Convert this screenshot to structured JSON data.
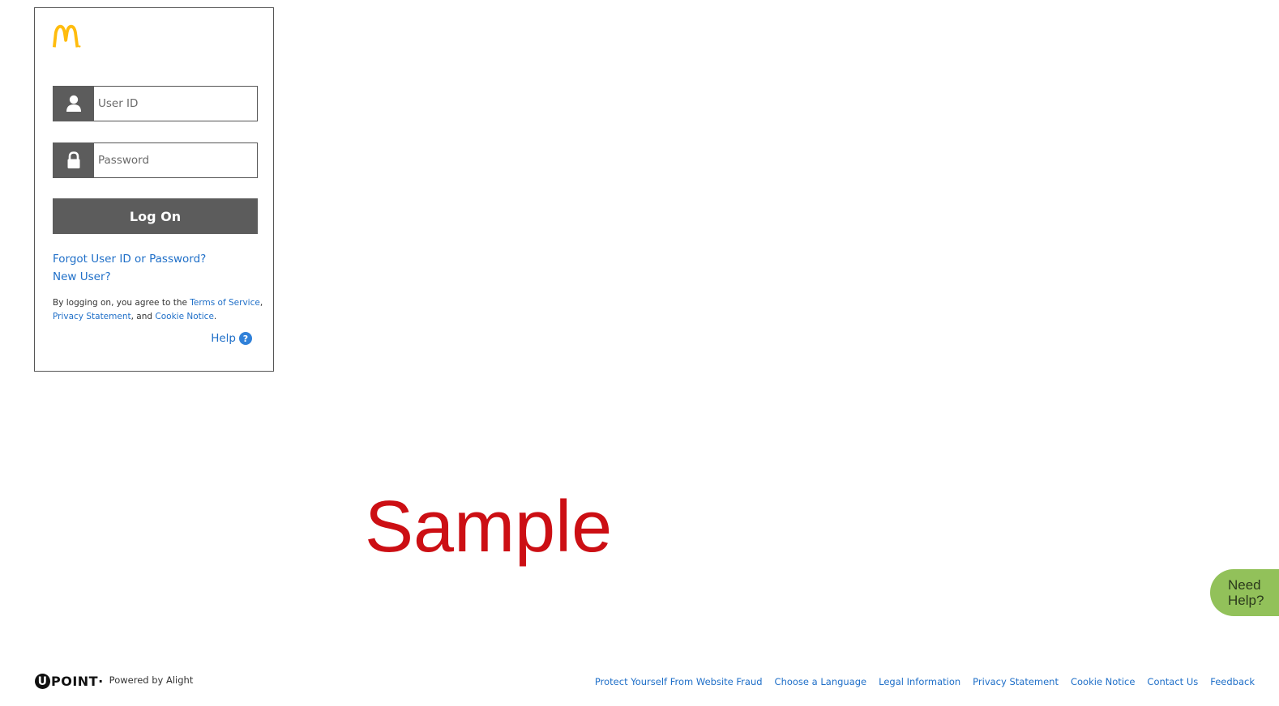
{
  "login": {
    "userid_placeholder": "User ID",
    "password_placeholder": "Password",
    "logon_label": "Log On",
    "forgot_label": "Forgot User ID or Password?",
    "newuser_label": "New User?",
    "agree_prefix": "By logging on, you agree to the ",
    "terms_label": "Terms of Service",
    "comma1": ",",
    "privacy_label": "Privacy Statement",
    "and_text": ", and ",
    "cookie_label": "Cookie Notice",
    "period": ".",
    "help_label": "Help",
    "help_icon_glyph": "?"
  },
  "watermark": "Sample",
  "need_help": {
    "line1": "Need",
    "line2": "Help?"
  },
  "footer": {
    "brand_u": "U",
    "brand_rest": "POINT",
    "brand_mark": "·",
    "powered_by": "Powered by Alight",
    "links": [
      "Protect Yourself From Website Fraud",
      "Choose a Language",
      "Legal Information",
      "Privacy Statement",
      "Cookie Notice",
      "Contact Us",
      "Feedback"
    ]
  },
  "colors": {
    "brand_yellow": "#ffbc0d",
    "button_gray": "#5c5c5c",
    "link_blue": "#1f6fc8",
    "watermark_red": "#cc0f14",
    "need_help_green": "#92c15a"
  },
  "icons": [
    "mcdonalds-logo",
    "user-icon",
    "lock-icon",
    "help-icon",
    "upoint-logo"
  ]
}
